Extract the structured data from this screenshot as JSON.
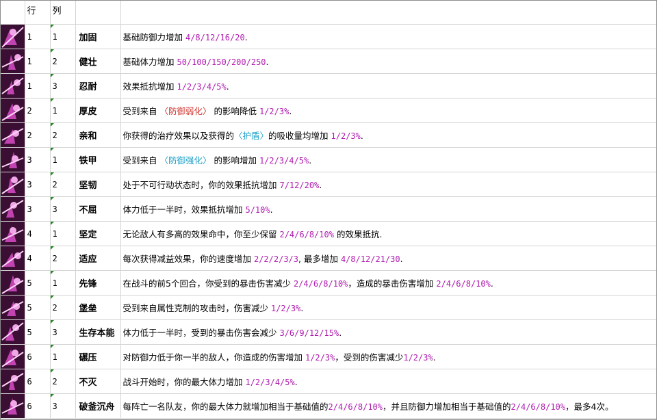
{
  "header": {
    "col_row": "行",
    "col_col": "列",
    "col_name": "",
    "col_desc": ""
  },
  "colors": {
    "value": "#b01ab0",
    "debuff": "#d0352f",
    "buff": "#1aa0c8",
    "icon_bg": "#3a0f33",
    "icon_fg": "#d94cc9"
  },
  "rows": [
    {
      "icon": "crossed-weapons-icon",
      "row": "1",
      "col": "1",
      "name": "加固",
      "desc": [
        {
          "t": "基础防御力增加 "
        },
        {
          "t": "4/8/12/16/20",
          "c": "val"
        },
        {
          "t": "."
        }
      ]
    },
    {
      "icon": "muscle-arm-icon",
      "row": "1",
      "col": "2",
      "name": "健壮",
      "desc": [
        {
          "t": "基础体力增加 "
        },
        {
          "t": "50/100/150/200/250",
          "c": "val"
        },
        {
          "t": "."
        }
      ]
    },
    {
      "icon": "warrior-icon",
      "row": "1",
      "col": "3",
      "name": "忍耐",
      "desc": [
        {
          "t": "效果抵抗增加 "
        },
        {
          "t": "1/2/3/4/5%",
          "c": "val"
        },
        {
          "t": "."
        }
      ]
    },
    {
      "icon": "beast-hide-icon",
      "row": "2",
      "col": "1",
      "name": "厚皮",
      "desc": [
        {
          "t": "受到来自 "
        },
        {
          "t": "〈防御弱化〉",
          "c": "neg"
        },
        {
          "t": " 的影响降低 "
        },
        {
          "t": "1/2/3%",
          "c": "val"
        },
        {
          "t": "."
        }
      ]
    },
    {
      "icon": "mask-icon",
      "row": "2",
      "col": "2",
      "name": "亲和",
      "desc": [
        {
          "t": "你获得的治疗效果以及获得的"
        },
        {
          "t": "〈护盾〉",
          "c": "pos"
        },
        {
          "t": "的吸收量均增加 "
        },
        {
          "t": "1/2/3%",
          "c": "val"
        },
        {
          "t": "."
        }
      ]
    },
    {
      "icon": "armor-icon",
      "row": "3",
      "col": "1",
      "name": "铁甲",
      "desc": [
        {
          "t": "受到来自 "
        },
        {
          "t": "〈防御强化〉",
          "c": "pos"
        },
        {
          "t": " 的影响增加 "
        },
        {
          "t": "1/2/3/4/5%",
          "c": "val"
        },
        {
          "t": "."
        }
      ]
    },
    {
      "icon": "knight-icon",
      "row": "3",
      "col": "2",
      "name": "坚韧",
      "desc": [
        {
          "t": "处于不可行动状态时，你的效果抵抗增加 "
        },
        {
          "t": "7/12/20%",
          "c": "val"
        },
        {
          "t": "."
        }
      ]
    },
    {
      "icon": "fist-icon",
      "row": "3",
      "col": "3",
      "name": "不屈",
      "desc": [
        {
          "t": "体力低于一半时，效果抵抗增加 "
        },
        {
          "t": "5/10%",
          "c": "val"
        },
        {
          "t": "."
        }
      ]
    },
    {
      "icon": "monk-icon",
      "row": "4",
      "col": "1",
      "name": "坚定",
      "desc": [
        {
          "t": "无论敌人有多高的效果命中，你至少保留 "
        },
        {
          "t": "2/4/6/8/10%",
          "c": "val"
        },
        {
          "t": " 的效果抵抗."
        }
      ]
    },
    {
      "icon": "arrows-up-icon",
      "row": "4",
      "col": "2",
      "name": "适应",
      "desc": [
        {
          "t": "每次获得减益效果，你的速度增加 "
        },
        {
          "t": "2/2/2/3/3",
          "c": "val"
        },
        {
          "t": ", 最多增加 "
        },
        {
          "t": "4/8/12/21/30",
          "c": "val"
        },
        {
          "t": "."
        }
      ]
    },
    {
      "icon": "sword-icon",
      "row": "5",
      "col": "1",
      "name": "先锋",
      "desc": [
        {
          "t": "在战斗的前5个回合，你受到的暴击伤害减少 "
        },
        {
          "t": "2/4/6/8/10%",
          "c": "val"
        },
        {
          "t": "，造成的暴击伤害增加 "
        },
        {
          "t": "2/4/6/8/10%",
          "c": "val"
        },
        {
          "t": "."
        }
      ]
    },
    {
      "icon": "fortress-icon",
      "row": "5",
      "col": "2",
      "name": "堡垒",
      "desc": [
        {
          "t": "受到来自属性克制的攻击时，伤害减少 "
        },
        {
          "t": "1/2/3%",
          "c": "val"
        },
        {
          "t": "."
        }
      ]
    },
    {
      "icon": "bear-icon",
      "row": "5",
      "col": "3",
      "name": "生存本能",
      "desc": [
        {
          "t": "体力低于一半时，受到的暴击伤害会减少 "
        },
        {
          "t": "3/6/9/12/15%",
          "c": "val"
        },
        {
          "t": "."
        }
      ]
    },
    {
      "icon": "chain-icon",
      "row": "6",
      "col": "1",
      "name": "碾压",
      "desc": [
        {
          "t": "对防御力低于你一半的敌人，你造成的伤害增加 "
        },
        {
          "t": "1/2/3%",
          "c": "val"
        },
        {
          "t": "，受到的伤害减少"
        },
        {
          "t": "1/2/3%",
          "c": "val"
        },
        {
          "t": "."
        }
      ]
    },
    {
      "icon": "ghost-icon",
      "row": "6",
      "col": "2",
      "name": "不灭",
      "desc": [
        {
          "t": "战斗开始时，你的最大体力增加 "
        },
        {
          "t": "1/2/3/4/5%",
          "c": "val"
        },
        {
          "t": "."
        }
      ]
    },
    {
      "icon": "ship-icon",
      "row": "6",
      "col": "3",
      "name": "破釜沉舟",
      "desc": [
        {
          "t": "每阵亡一名队友，你的最大体力就增加相当于基础值的"
        },
        {
          "t": "2/4/6/8/10%",
          "c": "val"
        },
        {
          "t": "，并且防御力增加相当于基础值的"
        },
        {
          "t": "2/4/6/8/10%",
          "c": "val"
        },
        {
          "t": "，最多4次。"
        }
      ]
    }
  ]
}
